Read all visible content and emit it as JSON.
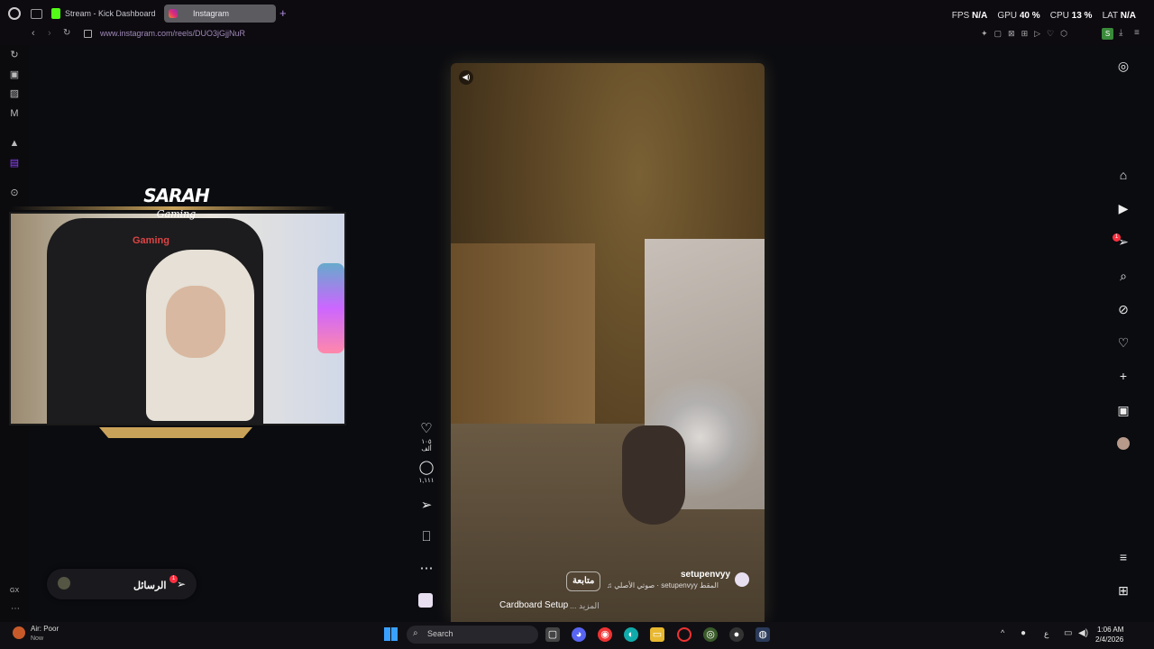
{
  "browser": {
    "tabs": [
      {
        "label": "Stream - Kick Dashboard"
      },
      {
        "label": "Instagram"
      }
    ],
    "url": "www.instagram.com/reels/DUO3jGjjNuR",
    "stats": {
      "fps_label": "FPS",
      "fps_value": "N/A",
      "gpu_label": "GPU",
      "gpu_value": "40 %",
      "cpu_label": "CPU",
      "cpu_value": "13 %",
      "lat_label": "LAT",
      "lat_value": "N/A"
    }
  },
  "reel": {
    "username": "setupenvyy",
    "follow_label": "متابعة",
    "audio_text": "♫ صوتي الأصلي · setupenvyy    المقط",
    "caption": "Cardboard Setup",
    "caption_more": "... المزيد",
    "actions": {
      "likes": "١٠٥ ألف",
      "comments": "١,١١١"
    }
  },
  "right_nav": {
    "notification_count": "1"
  },
  "webcam": {
    "logo_title": "SARAH",
    "logo_sub": "Gaming",
    "chair_brand": "Gaming"
  },
  "messages": {
    "label": "الرسائل",
    "badge": "1"
  },
  "taskbar": {
    "weather_line1": "Air: Poor",
    "weather_line2": "Now",
    "search_label": "Search",
    "time": "1:06 AM",
    "date": "2/4/2026",
    "lang": "ع"
  },
  "sidebar": {
    "gx_label": "GX"
  }
}
